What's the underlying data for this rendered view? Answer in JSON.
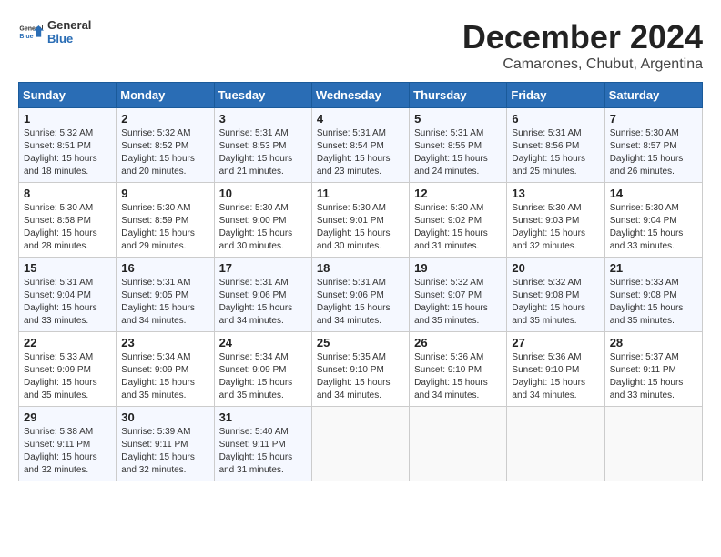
{
  "header": {
    "logo_general": "General",
    "logo_blue": "Blue",
    "month": "December 2024",
    "location": "Camarones, Chubut, Argentina"
  },
  "calendar": {
    "weekdays": [
      "Sunday",
      "Monday",
      "Tuesday",
      "Wednesday",
      "Thursday",
      "Friday",
      "Saturday"
    ],
    "weeks": [
      [
        {
          "day": "",
          "info": ""
        },
        {
          "day": "2",
          "info": "Sunrise: 5:32 AM\nSunset: 8:52 PM\nDaylight: 15 hours\nand 20 minutes."
        },
        {
          "day": "3",
          "info": "Sunrise: 5:31 AM\nSunset: 8:53 PM\nDaylight: 15 hours\nand 21 minutes."
        },
        {
          "day": "4",
          "info": "Sunrise: 5:31 AM\nSunset: 8:54 PM\nDaylight: 15 hours\nand 23 minutes."
        },
        {
          "day": "5",
          "info": "Sunrise: 5:31 AM\nSunset: 8:55 PM\nDaylight: 15 hours\nand 24 minutes."
        },
        {
          "day": "6",
          "info": "Sunrise: 5:31 AM\nSunset: 8:56 PM\nDaylight: 15 hours\nand 25 minutes."
        },
        {
          "day": "7",
          "info": "Sunrise: 5:30 AM\nSunset: 8:57 PM\nDaylight: 15 hours\nand 26 minutes."
        }
      ],
      [
        {
          "day": "1",
          "info": "Sunrise: 5:32 AM\nSunset: 8:51 PM\nDaylight: 15 hours\nand 18 minutes."
        },
        {
          "day": "9",
          "info": "Sunrise: 5:30 AM\nSunset: 8:59 PM\nDaylight: 15 hours\nand 29 minutes."
        },
        {
          "day": "10",
          "info": "Sunrise: 5:30 AM\nSunset: 9:00 PM\nDaylight: 15 hours\nand 30 minutes."
        },
        {
          "day": "11",
          "info": "Sunrise: 5:30 AM\nSunset: 9:01 PM\nDaylight: 15 hours\nand 30 minutes."
        },
        {
          "day": "12",
          "info": "Sunrise: 5:30 AM\nSunset: 9:02 PM\nDaylight: 15 hours\nand 31 minutes."
        },
        {
          "day": "13",
          "info": "Sunrise: 5:30 AM\nSunset: 9:03 PM\nDaylight: 15 hours\nand 32 minutes."
        },
        {
          "day": "14",
          "info": "Sunrise: 5:30 AM\nSunset: 9:04 PM\nDaylight: 15 hours\nand 33 minutes."
        }
      ],
      [
        {
          "day": "8",
          "info": "Sunrise: 5:30 AM\nSunset: 8:58 PM\nDaylight: 15 hours\nand 28 minutes."
        },
        {
          "day": "16",
          "info": "Sunrise: 5:31 AM\nSunset: 9:05 PM\nDaylight: 15 hours\nand 34 minutes."
        },
        {
          "day": "17",
          "info": "Sunrise: 5:31 AM\nSunset: 9:06 PM\nDaylight: 15 hours\nand 34 minutes."
        },
        {
          "day": "18",
          "info": "Sunrise: 5:31 AM\nSunset: 9:06 PM\nDaylight: 15 hours\nand 34 minutes."
        },
        {
          "day": "19",
          "info": "Sunrise: 5:32 AM\nSunset: 9:07 PM\nDaylight: 15 hours\nand 35 minutes."
        },
        {
          "day": "20",
          "info": "Sunrise: 5:32 AM\nSunset: 9:08 PM\nDaylight: 15 hours\nand 35 minutes."
        },
        {
          "day": "21",
          "info": "Sunrise: 5:33 AM\nSunset: 9:08 PM\nDaylight: 15 hours\nand 35 minutes."
        }
      ],
      [
        {
          "day": "15",
          "info": "Sunrise: 5:31 AM\nSunset: 9:04 PM\nDaylight: 15 hours\nand 33 minutes."
        },
        {
          "day": "23",
          "info": "Sunrise: 5:34 AM\nSunset: 9:09 PM\nDaylight: 15 hours\nand 35 minutes."
        },
        {
          "day": "24",
          "info": "Sunrise: 5:34 AM\nSunset: 9:09 PM\nDaylight: 15 hours\nand 35 minutes."
        },
        {
          "day": "25",
          "info": "Sunrise: 5:35 AM\nSunset: 9:10 PM\nDaylight: 15 hours\nand 34 minutes."
        },
        {
          "day": "26",
          "info": "Sunrise: 5:36 AM\nSunset: 9:10 PM\nDaylight: 15 hours\nand 34 minutes."
        },
        {
          "day": "27",
          "info": "Sunrise: 5:36 AM\nSunset: 9:10 PM\nDaylight: 15 hours\nand 34 minutes."
        },
        {
          "day": "28",
          "info": "Sunrise: 5:37 AM\nSunset: 9:11 PM\nDaylight: 15 hours\nand 33 minutes."
        }
      ],
      [
        {
          "day": "22",
          "info": "Sunrise: 5:33 AM\nSunset: 9:09 PM\nDaylight: 15 hours\nand 35 minutes."
        },
        {
          "day": "30",
          "info": "Sunrise: 5:39 AM\nSunset: 9:11 PM\nDaylight: 15 hours\nand 32 minutes."
        },
        {
          "day": "31",
          "info": "Sunrise: 5:40 AM\nSunset: 9:11 PM\nDaylight: 15 hours\nand 31 minutes."
        },
        {
          "day": "",
          "info": ""
        },
        {
          "day": "",
          "info": ""
        },
        {
          "day": "",
          "info": ""
        },
        {
          "day": ""
        }
      ],
      [
        {
          "day": "29",
          "info": "Sunrise: 5:38 AM\nSunset: 9:11 PM\nDaylight: 15 hours\nand 32 minutes."
        },
        {
          "day": "",
          "info": ""
        },
        {
          "day": "",
          "info": ""
        },
        {
          "day": "",
          "info": ""
        },
        {
          "day": "",
          "info": ""
        },
        {
          "day": "",
          "info": ""
        },
        {
          "day": "",
          "info": ""
        }
      ]
    ]
  }
}
